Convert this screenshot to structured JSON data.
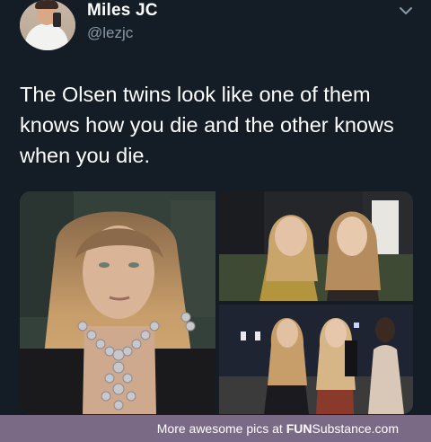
{
  "tweet": {
    "display_name": "Miles JC",
    "handle": "@lezjc",
    "text": "The Olsen twins look like one of them knows how you die and the other knows when you die."
  },
  "media": {
    "photos": [
      {
        "subject": "woman with long wavy blonde hair and jeweled necklace"
      },
      {
        "subject": "twins posing together in gold and dark outfits"
      },
      {
        "subject": "twins standing at gala event"
      }
    ]
  },
  "footer": {
    "prefix": "More awesome pics at ",
    "brand_fun": "FUN",
    "brand_substance": "Substance",
    "brand_suffix": ".com"
  },
  "colors": {
    "background": "#141d26",
    "handle": "#8899a6",
    "footer": "#7a6a86"
  },
  "icons": [
    "chevron-down-icon"
  ]
}
